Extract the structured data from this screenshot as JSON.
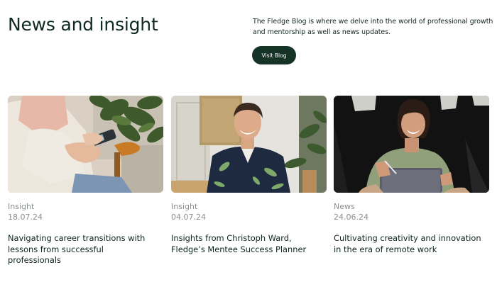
{
  "header": {
    "title": "News and insight",
    "description": "The Fledge Blog is where we delve into the world of professional growth and mentorship as well as news updates.",
    "button_label": "Visit Blog"
  },
  "posts": [
    {
      "category": "Insight",
      "date": "18.07.24",
      "title": "Navigating career transitions with lessons from successful professionals",
      "image_subject": "woman-holding-phone"
    },
    {
      "category": "Insight",
      "date": "04.07.24",
      "title": "Insights from Christoph Ward, Fledge’s Mentee Success Planner",
      "image_subject": "smiling-man-portrait"
    },
    {
      "category": "News",
      "date": "24.06.24",
      "title": "Cultivating creativity and innovation in the era of remote work",
      "image_subject": "woman-with-tablet"
    }
  ],
  "colors": {
    "brand_dark": "#163328",
    "text_dark": "#0e2a1e",
    "meta_grey": "#8a8f8c"
  }
}
